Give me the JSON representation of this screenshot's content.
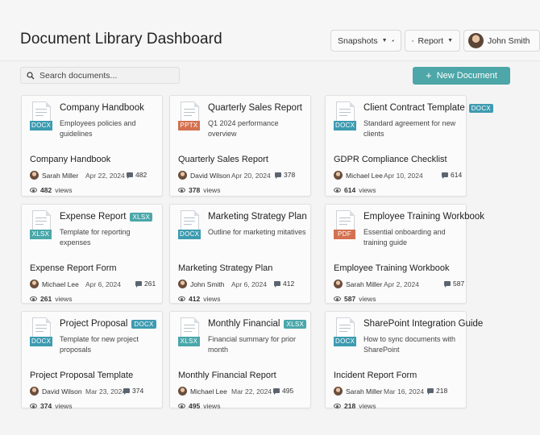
{
  "header": {
    "title": "Document Library Dashboard",
    "snapshots_label": "Snapshots",
    "report_label": "Report",
    "user_name": "John Smith"
  },
  "search": {
    "placeholder": "Search documents..."
  },
  "new_document_label": "New Document",
  "colors": {
    "accent": "#4da6a8",
    "docx": "#3d9bb0",
    "pptx": "#d4704f",
    "xlsx": "#4aa7aa",
    "pdf": "#d4704f"
  },
  "icons": {
    "search": "search-icon",
    "plus": "plus-icon",
    "pin": "pin-icon",
    "comments": "comment-icon",
    "views": "eye-icon"
  },
  "cards": [
    {
      "title": "Company Handbook",
      "badge": "",
      "type": "DOCX",
      "type_color": "#3d9bb0",
      "description": "Employees policies and guidelines",
      "name": "Company Handbook",
      "author": "Sarah Miller",
      "date": "Apr 22, 2024",
      "comments": "482",
      "views": "482",
      "views_label": "views"
    },
    {
      "title": "Quarterly Sales Report",
      "badge": "",
      "type": "PPTX",
      "type_color": "#d4704f",
      "description": "Q1 2024 performance overview",
      "name": "Quarterly Sales Report",
      "author": "David Wilson",
      "date": "Apr 20, 2024",
      "comments": "378",
      "views": "378",
      "views_label": "views"
    },
    {
      "title": "Client Contract Template",
      "badge": "DOCX",
      "type": "DOCX",
      "type_color": "#3d9bb0",
      "description": "Standard agreement for new clients",
      "name": "GDPR Compliance Checklist",
      "author": "Michael Lee",
      "date": "Apr 10, 2024",
      "comments": "614",
      "views": "614",
      "views_label": "views"
    },
    {
      "title": "Expense Report",
      "badge": "XLSX",
      "type": "XLSX",
      "type_color": "#4aa7aa",
      "description": "Template for reporting expenses",
      "name": "Expense Report Form",
      "author": "Michael Lee",
      "date": "Apr 6, 2024",
      "comments": "261",
      "views": "261",
      "views_label": "views"
    },
    {
      "title": "Marketing Strategy Plan",
      "badge": "",
      "type": "DOCX",
      "type_color": "#3d9bb0",
      "description": "Outline for marketing mitatives",
      "name": "Marketing Strategy Plan",
      "author": "John Smith",
      "date": "Apr 6, 2024",
      "comments": "412",
      "views": "412",
      "views_label": "views"
    },
    {
      "title": "Employee Training Workbook",
      "badge": "",
      "type": "PDF",
      "type_color": "#d4704f",
      "description": "Essential onboarding and training guide",
      "name": "Employee Training Workbook",
      "author": "Sarah Miller",
      "date": "Apr 2, 2024",
      "comments": "587",
      "views": "587",
      "views_label": "views"
    },
    {
      "title": "Project Proposal",
      "badge": "DOCX",
      "type": "DOCX",
      "type_color": "#3d9bb0",
      "description": "Template for new project proposals",
      "name": "Project Proposal Template",
      "author": "David Wilson",
      "date": "Mar 23, 2024",
      "comments": "374",
      "views": "374",
      "views_label": "views"
    },
    {
      "title": "Monthly Financial",
      "badge": "XLSX",
      "type": "XLSX",
      "type_color": "#4aa7aa",
      "description": "Financial summary for prior month",
      "name": "Monthly Financial Report",
      "author": "Michael Lee",
      "date": "Mar 22, 2024",
      "comments": "495",
      "views": "495",
      "views_label": "views"
    },
    {
      "title": "SharePoint Integration Guide",
      "badge": "",
      "type": "DOCX",
      "type_color": "#3d9bb0",
      "description": "How to sync documents with SharePoint",
      "name": "Incident Report Form",
      "author": "Sarah Miller",
      "date": "Mar 16, 2024",
      "comments": "218",
      "views": "218",
      "views_label": "views"
    }
  ]
}
